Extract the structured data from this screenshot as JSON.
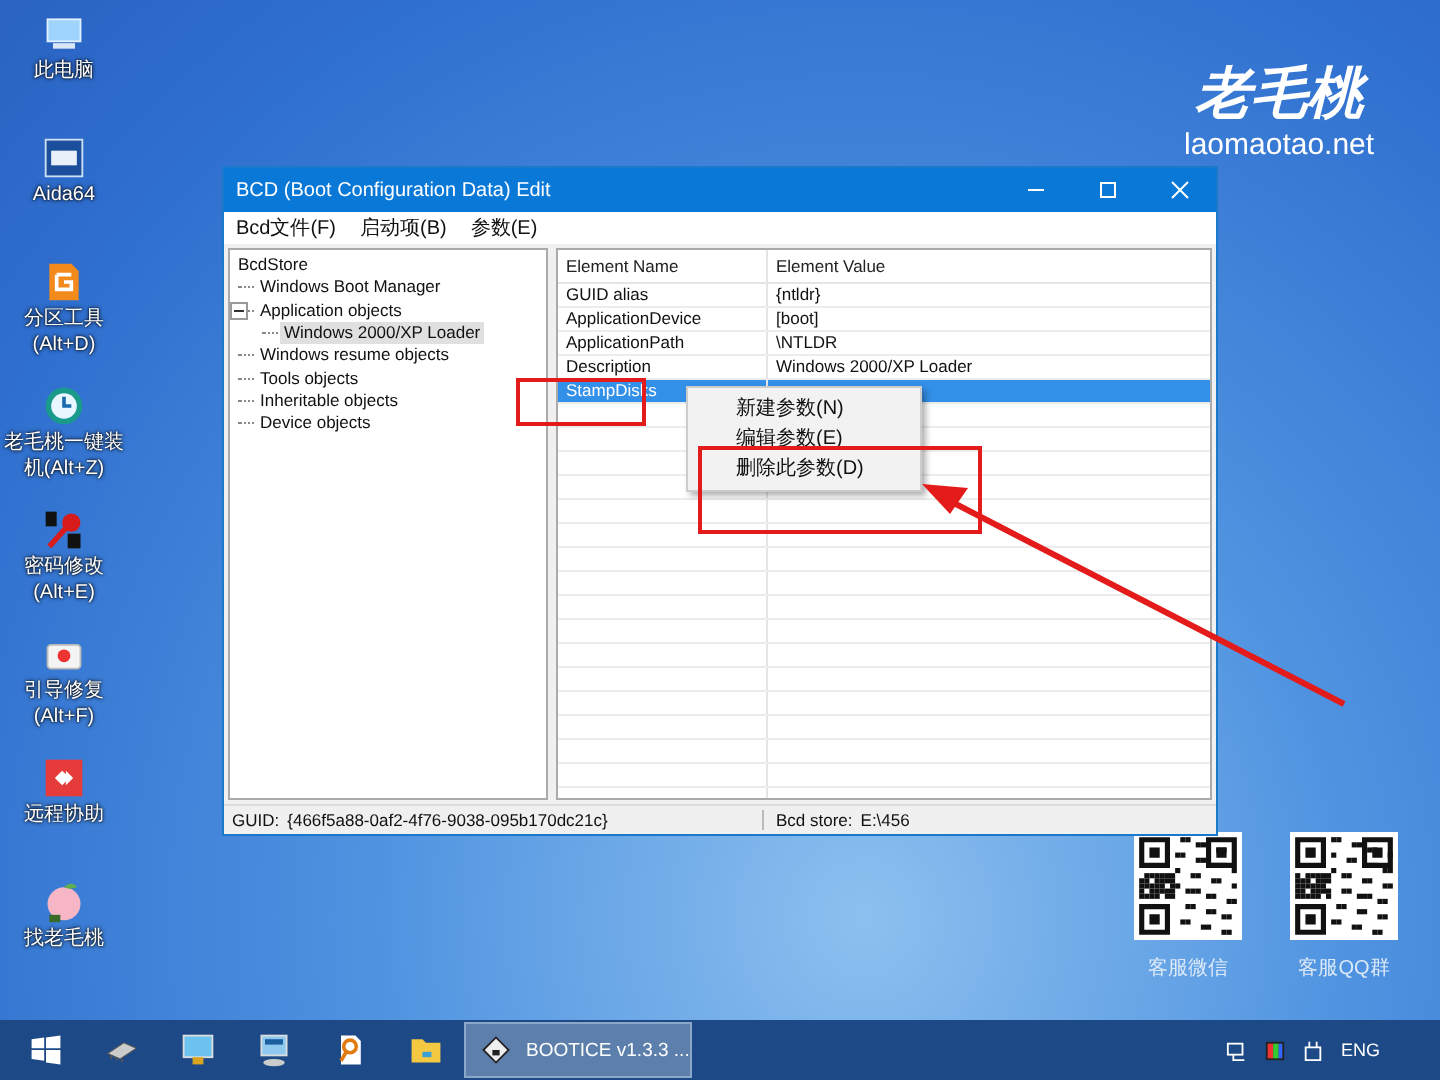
{
  "desktop_icons": [
    {
      "label": [
        "此电脑"
      ],
      "kind": "pc"
    },
    {
      "label": [
        "Aida64"
      ],
      "kind": "aida"
    },
    {
      "label": [
        "分区工具",
        "(Alt+D)"
      ],
      "kind": "partition"
    },
    {
      "label": [
        "老毛桃一键装",
        "机(Alt+Z)"
      ],
      "kind": "restore"
    },
    {
      "label": [
        "密码修改",
        "(Alt+E)"
      ],
      "kind": "password"
    },
    {
      "label": [
        "引导修复",
        "(Alt+F)"
      ],
      "kind": "repair"
    },
    {
      "label": [
        "远程协助"
      ],
      "kind": "remote"
    },
    {
      "label": [
        "找老毛桃"
      ],
      "kind": "peach"
    }
  ],
  "logo": {
    "name": "老毛桃",
    "url": "laomaotao.net"
  },
  "qr_codes": [
    {
      "caption": "客服微信"
    },
    {
      "caption": "客服QQ群"
    }
  ],
  "window": {
    "title": "BCD (Boot Configuration Data) Edit",
    "menu": [
      "Bcd文件(F)",
      "启动项(B)",
      "参数(E)"
    ],
    "tree": [
      {
        "label": "BcdStore",
        "selected": false,
        "children": [
          {
            "label": "Windows Boot Manager",
            "selected": false
          },
          {
            "label": "Application objects",
            "selected": false,
            "expanded": true,
            "children": [
              {
                "label": "Windows 2000/XP Loader",
                "selected": true
              }
            ]
          },
          {
            "label": "Windows resume objects",
            "selected": false
          },
          {
            "label": "Tools objects",
            "selected": false
          },
          {
            "label": "Inheritable objects",
            "selected": false
          },
          {
            "label": "Device objects",
            "selected": false
          }
        ]
      }
    ],
    "table": {
      "columns": [
        "Element Name",
        "Element Value"
      ],
      "rows": [
        {
          "name": "GUID alias",
          "value": "{ntldr}",
          "selected": false
        },
        {
          "name": "ApplicationDevice",
          "value": "[boot]",
          "selected": false
        },
        {
          "name": "ApplicationPath",
          "value": "\\NTLDR",
          "selected": false
        },
        {
          "name": "Description",
          "value": "Windows 2000/XP Loader",
          "selected": false
        },
        {
          "name": "StampDisks",
          "selected": true
        }
      ]
    },
    "context_menu": [
      "新建参数(N)",
      "编辑参数(E)",
      "删除此参数(D)"
    ],
    "status_bar": {
      "guid_label": "GUID:",
      "guid": "{466f5a88-0af2-4f76-9038-095b170dc21c}",
      "store_label": "Bcd store:",
      "store": "E:\\456"
    }
  },
  "taskbar": {
    "items": [
      {
        "kind": "start",
        "active": false
      },
      {
        "kind": "chip",
        "active": false
      },
      {
        "kind": "monitor",
        "active": false
      },
      {
        "kind": "terminal",
        "active": false
      },
      {
        "kind": "search-doc",
        "active": false
      },
      {
        "kind": "folder",
        "active": false
      },
      {
        "kind": "disk",
        "label": "BOOTICE v1.3.3 ...",
        "active": true
      }
    ],
    "tray": [
      {
        "kind": "network"
      },
      {
        "kind": "color"
      },
      {
        "kind": "usb"
      },
      {
        "kind": "text",
        "label": "ENG"
      }
    ]
  }
}
